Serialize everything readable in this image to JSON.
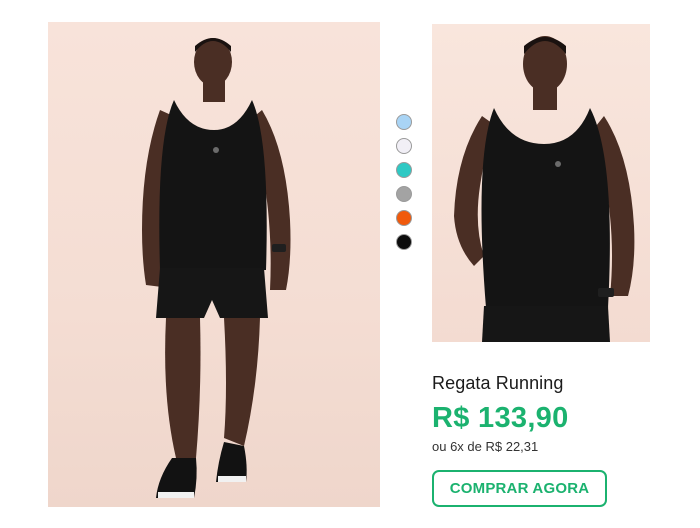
{
  "product": {
    "name": "Regata Running",
    "price": "R$ 133,90",
    "installments": "ou 6x de R$ 22,31",
    "buy_label": "COMPRAR AGORA"
  },
  "swatches": [
    {
      "name": "light-blue",
      "color": "#a9d4f5"
    },
    {
      "name": "white",
      "color": "#f1eff6"
    },
    {
      "name": "turquoise",
      "color": "#2ec9c4"
    },
    {
      "name": "gray",
      "color": "#a3a3a3"
    },
    {
      "name": "orange",
      "color": "#f05a0c"
    },
    {
      "name": "black",
      "color": "#0c0c0c"
    }
  ],
  "colors": {
    "accent": "#1bb26f"
  }
}
